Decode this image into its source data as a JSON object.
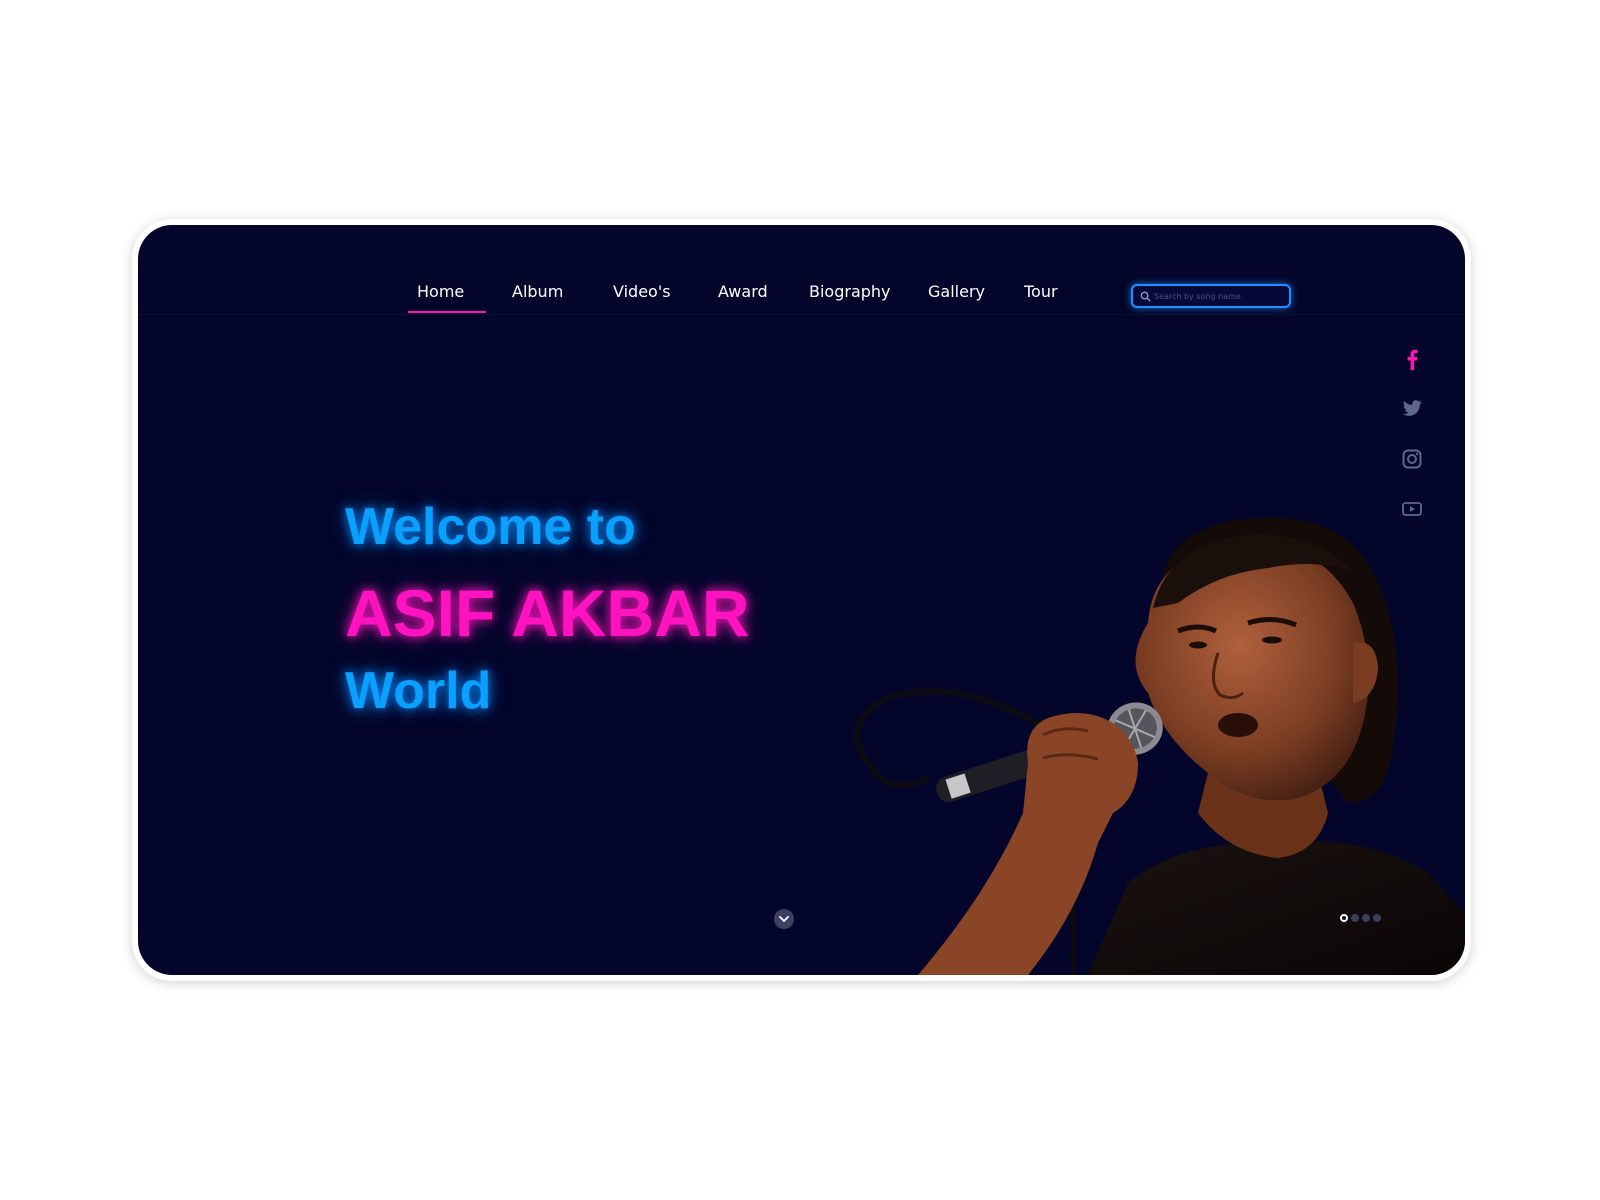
{
  "nav": {
    "items": [
      {
        "label": "Home",
        "active": true
      },
      {
        "label": "Album"
      },
      {
        "label": "Video's"
      },
      {
        "label": "Award"
      },
      {
        "label": "Biography"
      },
      {
        "label": "Gallery"
      },
      {
        "label": "Tour"
      }
    ],
    "search_placeholder": "Search by song name",
    "active_color": "#ff14b4",
    "search_border_color": "#1e90ff"
  },
  "hero": {
    "welcome": "Welcome to",
    "artist": "ASIF AKBAR",
    "world": "World",
    "welcome_color": "#0aa0ff",
    "artist_color": "#ff12c0"
  },
  "social": [
    {
      "icon": "facebook-icon",
      "color": "#ff14b4"
    },
    {
      "icon": "twitter-icon",
      "color": "#5f6690"
    },
    {
      "icon": "instagram-icon",
      "color": "#5f6690"
    },
    {
      "icon": "youtube-icon",
      "color": "#5f6690"
    }
  ],
  "carousel": {
    "slide_count": 4,
    "active_index": 0
  },
  "colors": {
    "background": "#03062a",
    "page": "#ffffff"
  }
}
